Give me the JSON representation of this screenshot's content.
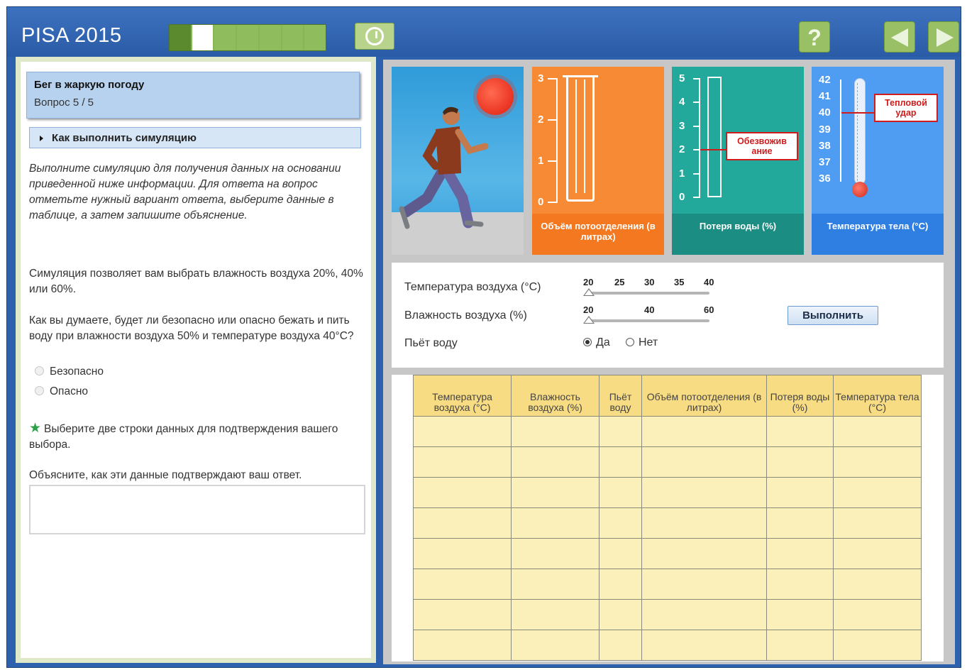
{
  "header": {
    "title": "PISA 2015",
    "progress": {
      "total": 7,
      "completed": 1,
      "current": 2
    },
    "icons": {
      "timer": "timer-icon",
      "help": "help-icon",
      "prev": "previous-arrow-icon",
      "next": "next-arrow-icon"
    },
    "help_label": "?"
  },
  "left": {
    "unit_title": "Бег в жаркую погоду",
    "question_number": "Вопрос 5 / 5",
    "howto_label": "Как выполнить симуляцию",
    "instructions": "Выполните симуляцию для получения данных на основании приведенной ниже информации. Для ответа на вопрос отметьте нужный вариант ответа, выберите данные в таблице, а затем запишите объяснение.",
    "sim_description": "Симуляция позволяет вам выбрать влажность воздуха 20%, 40% или 60%.",
    "question": "Как вы думаете, будет ли безопасно или опасно бежать и пить воду при влажности воздуха 50% и температуре воздуха 40°C?",
    "options": [
      "Безопасно",
      "Опасно"
    ],
    "select_hint": "Выберите две строки данных для подтверждения вашего выбора.",
    "explain_prompt": "Объясните, как эти данные подтверждают ваш ответ.",
    "answer_value": ""
  },
  "gauges": {
    "sweat": {
      "label": "Объём потоотделения (в литрах)",
      "ticks": [
        "3",
        "2",
        "1",
        "0"
      ]
    },
    "water": {
      "label": "Потеря воды (%)",
      "ticks": [
        "5",
        "4",
        "3",
        "2",
        "1",
        "0"
      ],
      "callout": "Обезвожив ание"
    },
    "temp": {
      "label": "Температура тела (°C)",
      "ticks": [
        "42",
        "41",
        "40",
        "39",
        "38",
        "37",
        "36"
      ],
      "callout": "Тепловой удар"
    }
  },
  "controls": {
    "air_temp_label": "Температура воздуха (°C)",
    "air_temp_values": [
      "20",
      "25",
      "30",
      "35",
      "40"
    ],
    "humidity_label": "Влажность воздуха (%)",
    "humidity_values": [
      "20",
      "40",
      "60"
    ],
    "drinks_label": "Пьёт воду",
    "yes_label": "Да",
    "no_label": "Нет",
    "drinks_selected": "Да",
    "run_label": "Выполнить"
  },
  "table": {
    "headers": [
      "Температура воздуха (°C)",
      "Влажность воздуха (%)",
      "Пьёт воду",
      "Объём потоотделения (в литрах)",
      "Потеря воды (%)",
      "Температура тела (°C)"
    ],
    "rows": [
      [
        "",
        "",
        "",
        "",
        "",
        ""
      ],
      [
        "",
        "",
        "",
        "",
        "",
        ""
      ],
      [
        "",
        "",
        "",
        "",
        "",
        ""
      ],
      [
        "",
        "",
        "",
        "",
        "",
        ""
      ],
      [
        "",
        "",
        "",
        "",
        "",
        ""
      ],
      [
        "",
        "",
        "",
        "",
        "",
        ""
      ],
      [
        "",
        "",
        "",
        "",
        "",
        ""
      ],
      [
        "",
        "",
        "",
        "",
        "",
        ""
      ]
    ]
  },
  "colors": {
    "header_blue": "#2e61ad",
    "accent_green": "#9ac065",
    "sweat_orange": "#f78b35",
    "water_teal": "#23a99c",
    "temp_blue": "#4f9cf3",
    "alert_red": "#d01c1c",
    "table_yellow": "#f8dc83"
  }
}
